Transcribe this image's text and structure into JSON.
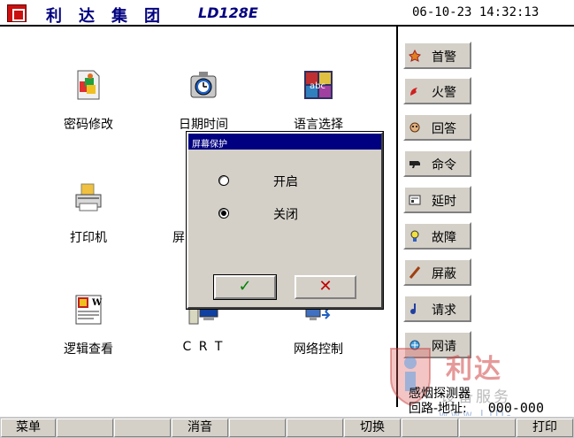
{
  "title": {
    "brand": "利达集团",
    "model": "LD128E",
    "datetime": "06-10-23  14:32:13"
  },
  "apps": [
    {
      "label": "密码修改",
      "icon": "password-icon"
    },
    {
      "label": "日期时间",
      "icon": "clock-icon"
    },
    {
      "label": "语言选择",
      "icon": "language-icon"
    },
    {
      "label": "打印机",
      "icon": "printer-icon"
    },
    {
      "label": "屏",
      "icon": "screen-icon"
    },
    {
      "label": "逻辑查看",
      "icon": "logic-doc-icon"
    },
    {
      "label": "C R T",
      "icon": "crt-icon"
    },
    {
      "label": "网络控制",
      "icon": "network-icon"
    }
  ],
  "right_panel": [
    {
      "label": "首警",
      "icon": "first-alarm-icon"
    },
    {
      "label": "火警",
      "icon": "fire-alarm-icon"
    },
    {
      "label": "回答",
      "icon": "answer-icon"
    },
    {
      "label": "命令",
      "icon": "command-icon"
    },
    {
      "label": "延时",
      "icon": "delay-icon"
    },
    {
      "label": "故障",
      "icon": "fault-icon"
    },
    {
      "label": "屏蔽",
      "icon": "shield-icon"
    },
    {
      "label": "请求",
      "icon": "request-icon"
    },
    {
      "label": "网请",
      "icon": "network-request-icon"
    }
  ],
  "dialog": {
    "title": "屏幕保护",
    "option_on": "开启",
    "option_off": "关闭",
    "selected": "关闭",
    "ok": "✓",
    "cancel": "✕"
  },
  "info": {
    "detector": "感烟探测器",
    "address_label": "回路-地址:",
    "address_value": "000-000"
  },
  "bottom_bar": {
    "menu": "菜单",
    "mute": "消音",
    "switch": "切换",
    "print": "打印"
  },
  "watermark": {
    "name": "利达",
    "subtitle": "设备服务",
    "url": "www.LiD-FW.com"
  },
  "colors": {
    "title_blue": "#000080",
    "dialog_title_bg": "#000080",
    "button_face": "#d4d0c8",
    "ok_green": "#008000",
    "cancel_red": "#c00000",
    "logo_red": "#cc1010"
  }
}
